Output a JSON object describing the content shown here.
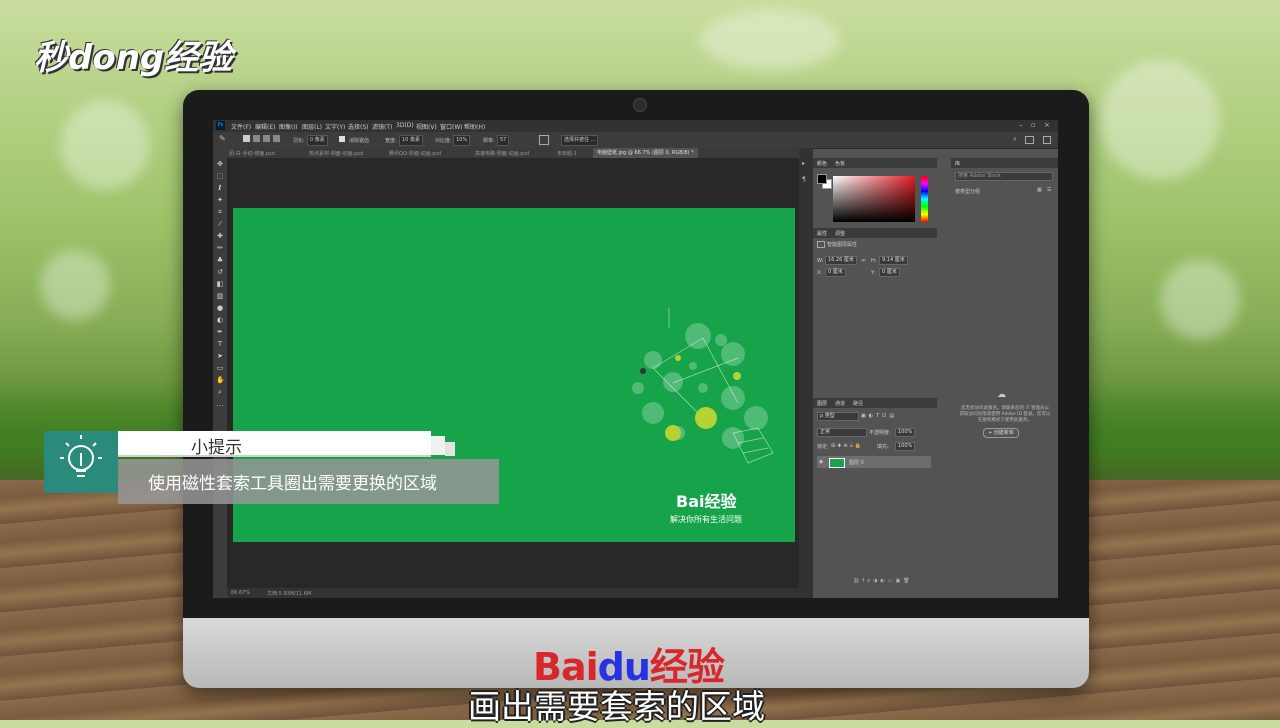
{
  "watermark": {
    "text": "秒dong经验"
  },
  "monitor": {
    "brand": {
      "part1": "Bai",
      "part2": "du",
      "part3": "经验"
    }
  },
  "photoshop": {
    "app_icon": "Ps",
    "menu": [
      "文件(F)",
      "编辑(E)",
      "图像(I)",
      "图层(L)",
      "文字(Y)",
      "选择(S)",
      "滤镜(T)",
      "3D(D)",
      "视图(V)",
      "窗口(W)",
      "帮助(H)"
    ],
    "window_controls": [
      "–",
      "▫",
      "×"
    ],
    "options": {
      "feather_label": "羽化:",
      "feather_value": "0 像素",
      "antialias_label": "消除锯齿",
      "width_label": "宽度:",
      "width_value": "10 像素",
      "contrast_label": "对比度:",
      "contrast_value": "10%",
      "frequency_label": "频率:",
      "frequency_value": "57",
      "select_mask_button": "选择并遮住 ..."
    },
    "tabs": [
      {
        "label": "团-白-手动-侧面.psd",
        "active": false
      },
      {
        "label": "热点素材-侧面-动画.psd",
        "active": false
      },
      {
        "label": "腾讯QQ-封面-动画.psd",
        "active": false
      },
      {
        "label": "高速电路-侧面-动画.psd",
        "active": false
      },
      {
        "label": "未标题-1",
        "active": false
      },
      {
        "label": "电脑壁纸.jpg @ 66.7% (图层 0, RGB/8) *",
        "active": true
      }
    ],
    "document": {
      "logo_text": "Bai经验",
      "slogan": "解决你所有生活问题",
      "bg_color": "#16a34a"
    },
    "status": {
      "zoom": "66.67%",
      "doc_info": "文档:5.93M/11.6M"
    },
    "color_panel": {
      "tabs": [
        "颜色",
        "色板"
      ]
    },
    "properties_panel": {
      "tabs": [
        "属性",
        "调整"
      ],
      "title": "智能图层属性",
      "w_label": "W:",
      "w_value": "16.26 厘米",
      "h_label": "H:",
      "h_value": "9.14 厘米",
      "x_label": "X:",
      "x_value": "0 厘米",
      "y_label": "Y:",
      "y_value": "0 厘米"
    },
    "layers_panel": {
      "tabs": [
        "图层",
        "通道",
        "路径"
      ],
      "filter_label": "ρ 类型",
      "blend_mode": "正常",
      "opacity_label": "不透明度:",
      "opacity_value": "100%",
      "lock_label": "锁定:",
      "fill_label": "填充:",
      "fill_value": "100%",
      "layer_name": "图层 0"
    },
    "libraries_panel": {
      "tab": "库",
      "search_placeholder": "搜索 Adobe Stock",
      "view_label": "按类型分组",
      "message": "您无权访问此服务。请联系您的 IT 管理员以获取访问权限或使用 Adobe ID 登录。您可以在脱机模式下使用此服务。",
      "create_button": "+ 创建新库"
    }
  },
  "tip": {
    "title": "小提示",
    "body": "使用磁性套索工具圈出需要更换的区域"
  },
  "subtitle": "画出需要套索的区域"
}
